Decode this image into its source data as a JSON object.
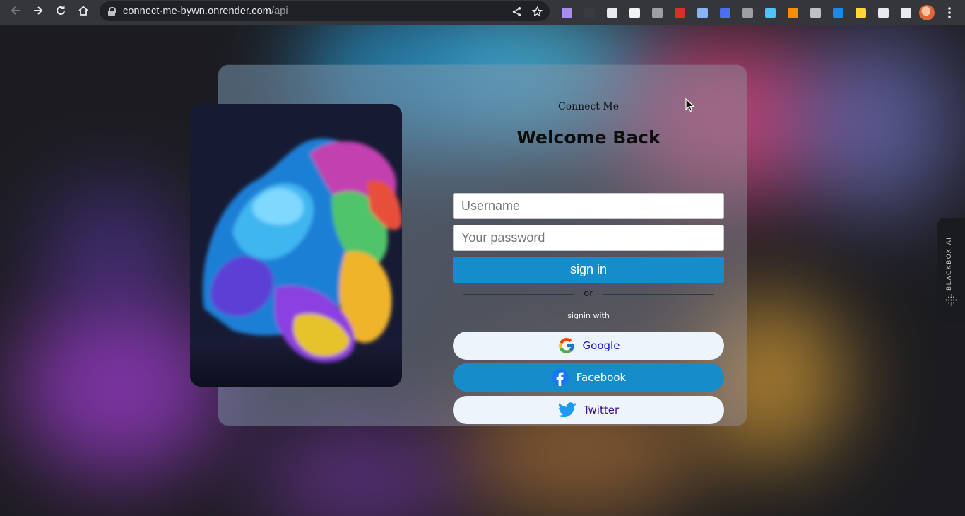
{
  "browser": {
    "url_host": "connect-me-bywn.onrender.com",
    "url_path": "/api",
    "extensions": [
      {
        "name": "crystal-ext",
        "color": "#a78bfa"
      },
      {
        "name": "dark-ext",
        "color": "#3a3b3f"
      },
      {
        "name": "react-ext",
        "color": "#e8eaed"
      },
      {
        "name": "b-ext",
        "color": "#f1f3f4"
      },
      {
        "name": "z-ext",
        "color": "#9aa0a6"
      },
      {
        "name": "calendar-ext",
        "color": "#d93025"
      },
      {
        "name": "docs-ext",
        "color": "#8ab4f8"
      },
      {
        "name": "hex-ext",
        "color": "#4c6ef5"
      },
      {
        "name": "ruler-ext",
        "color": "#9aa0a6"
      },
      {
        "name": "diamond-ext",
        "color": "#4fc3f7"
      },
      {
        "name": "firefox-ext",
        "color": "#fb8c00"
      },
      {
        "name": "cloud-ext",
        "color": "#bdc1c6"
      },
      {
        "name": "shield-ext",
        "color": "#1e88e5"
      },
      {
        "name": "pointer-ext",
        "color": "#fdd835"
      },
      {
        "name": "puzzle-ext",
        "color": "#e8eaed"
      },
      {
        "name": "sidepanel-ext",
        "color": "#e8eaed"
      }
    ]
  },
  "login": {
    "brand": "Connect Me",
    "title": "Welcome Back",
    "username_placeholder": "Username",
    "password_placeholder": "Your password",
    "signin_label": "sign in",
    "or_label": "or",
    "signin_with_label": "signin with",
    "google_label": "Google",
    "facebook_label": "Facebook",
    "twitter_label": "Twitter"
  },
  "blackbox": {
    "label": "BLACKBOX AI"
  },
  "colors": {
    "primary": "#178ccb",
    "social_light": "#eef4fb",
    "google_text": "#1418c8",
    "twitter_text": "#3b0d86"
  }
}
